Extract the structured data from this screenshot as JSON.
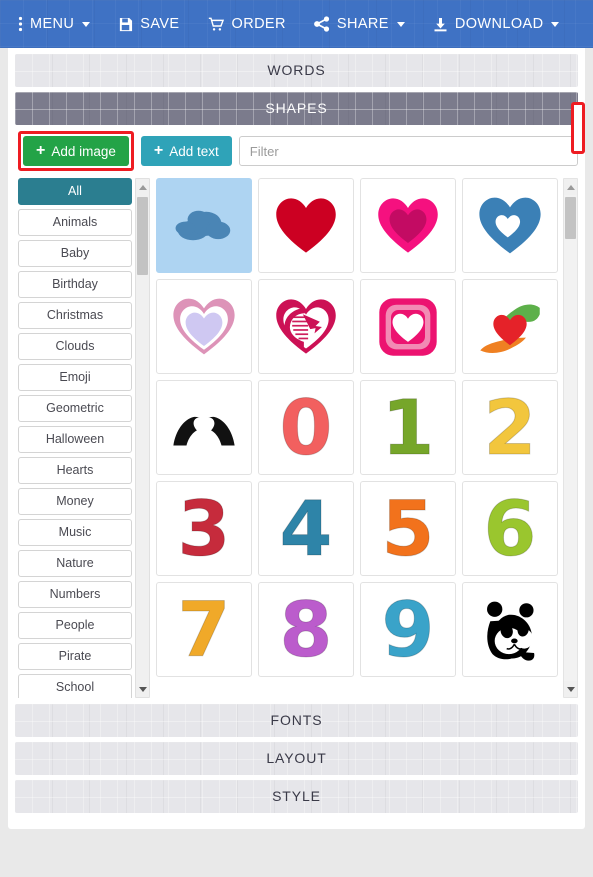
{
  "toolbar": {
    "items": [
      {
        "label": "MENU",
        "icon": "vertical-dots-icon",
        "caret": true
      },
      {
        "label": "SAVE",
        "icon": "floppy-disk-icon",
        "caret": false
      },
      {
        "label": "ORDER",
        "icon": "shopping-cart-icon",
        "caret": false
      },
      {
        "label": "SHARE",
        "icon": "share-nodes-icon",
        "caret": true
      },
      {
        "label": "DOWNLOAD",
        "icon": "download-arrow-icon",
        "caret": true
      }
    ],
    "background_color": "#3f72c4"
  },
  "sections": {
    "words": "WORDS",
    "shapes": "SHAPES",
    "fonts": "FONTS",
    "layout": "LAYOUT",
    "style": "STYLE"
  },
  "actions": {
    "add_image": "Add image",
    "add_text": "Add text",
    "plus": "+",
    "add_image_color": "#23a347",
    "add_text_color": "#2fa3b8",
    "highlight_color": "#ee1c22"
  },
  "search": {
    "placeholder": "Filter",
    "value": ""
  },
  "categories": {
    "active": "All",
    "active_color": "#2b7e90",
    "items": [
      "All",
      "Animals",
      "Baby",
      "Birthday",
      "Christmas",
      "Clouds",
      "Emoji",
      "Geometric",
      "Halloween",
      "Hearts",
      "Money",
      "Music",
      "Nature",
      "Numbers",
      "People",
      "Pirate",
      "School"
    ]
  },
  "gallery": {
    "tiles": [
      {
        "name": "cloud",
        "kind": "cloud",
        "color": "#4a85b5",
        "bg": "#aed4f2"
      },
      {
        "name": "heart-solid-red",
        "kind": "heart",
        "color": "#cc0022"
      },
      {
        "name": "heart-double-pink",
        "kind": "heart-double",
        "color": "#f5117f",
        "inner": "#c30b63"
      },
      {
        "name": "heart-blue-cutout",
        "kind": "heart-cutout",
        "color": "#3b80b6"
      },
      {
        "name": "heart-outline-lavender",
        "kind": "heart-ring",
        "color": "#dd93b8",
        "inner": "#cfc8f2"
      },
      {
        "name": "heart-swirl-crimson",
        "kind": "heart-swirl",
        "color": "#cc1155"
      },
      {
        "name": "heart-square-frame",
        "kind": "heart-square",
        "color": "#ec1370",
        "mid": "#f28bb4"
      },
      {
        "name": "hands-holding-heart",
        "kind": "hands-heart",
        "color": "#e52229",
        "green": "#5db04a",
        "orange": "#ef8022"
      },
      {
        "name": "hands-heart-silhouette",
        "kind": "hands-silhouette",
        "color": "#111111"
      },
      {
        "name": "digit-zero",
        "kind": "digit",
        "char": "0",
        "color": "#f2605f"
      },
      {
        "name": "digit-one",
        "kind": "digit",
        "char": "1",
        "color": "#76a62a"
      },
      {
        "name": "digit-two",
        "kind": "digit",
        "char": "2",
        "color": "#f2c63d"
      },
      {
        "name": "digit-three",
        "kind": "digit",
        "char": "3",
        "color": "#c62b3c"
      },
      {
        "name": "digit-four",
        "kind": "digit",
        "char": "4",
        "color": "#2e84a8"
      },
      {
        "name": "digit-five",
        "kind": "digit",
        "char": "5",
        "color": "#f2721c"
      },
      {
        "name": "digit-six",
        "kind": "digit",
        "char": "6",
        "color": "#9ac62e"
      },
      {
        "name": "digit-seven",
        "kind": "digit",
        "char": "7",
        "color": "#f0a929"
      },
      {
        "name": "digit-eight",
        "kind": "digit",
        "char": "8",
        "color": "#bb5ccc"
      },
      {
        "name": "digit-nine",
        "kind": "digit",
        "char": "9",
        "color": "#3aa3c9"
      },
      {
        "name": "panda-logo",
        "kind": "panda",
        "color": "#000000"
      }
    ]
  }
}
